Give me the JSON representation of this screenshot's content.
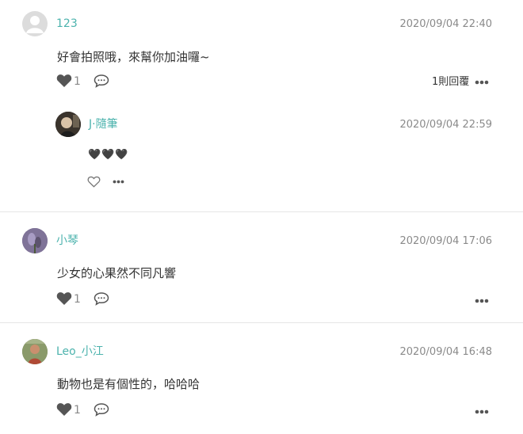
{
  "comments": [
    {
      "username": "123",
      "timestamp": "2020/09/04 22:40",
      "text": "好會拍照哦，來幫你加油囉~",
      "like_count": "1",
      "reply_count": "1則回覆",
      "reply": {
        "username": "J·隨筆",
        "timestamp": "2020/09/04 22:59",
        "text": "🖤🖤🖤"
      }
    },
    {
      "username": "小琴",
      "timestamp": "2020/09/04 17:06",
      "text": "少女的心果然不同凡響",
      "like_count": "1"
    },
    {
      "username": "Leo_小江",
      "timestamp": "2020/09/04 16:48",
      "text": "動物也是有個性的，哈哈哈",
      "like_count": "1"
    }
  ],
  "colors": {
    "username": "#4cb3ad",
    "icon": "#555555",
    "divider": "#e6e6e6"
  }
}
